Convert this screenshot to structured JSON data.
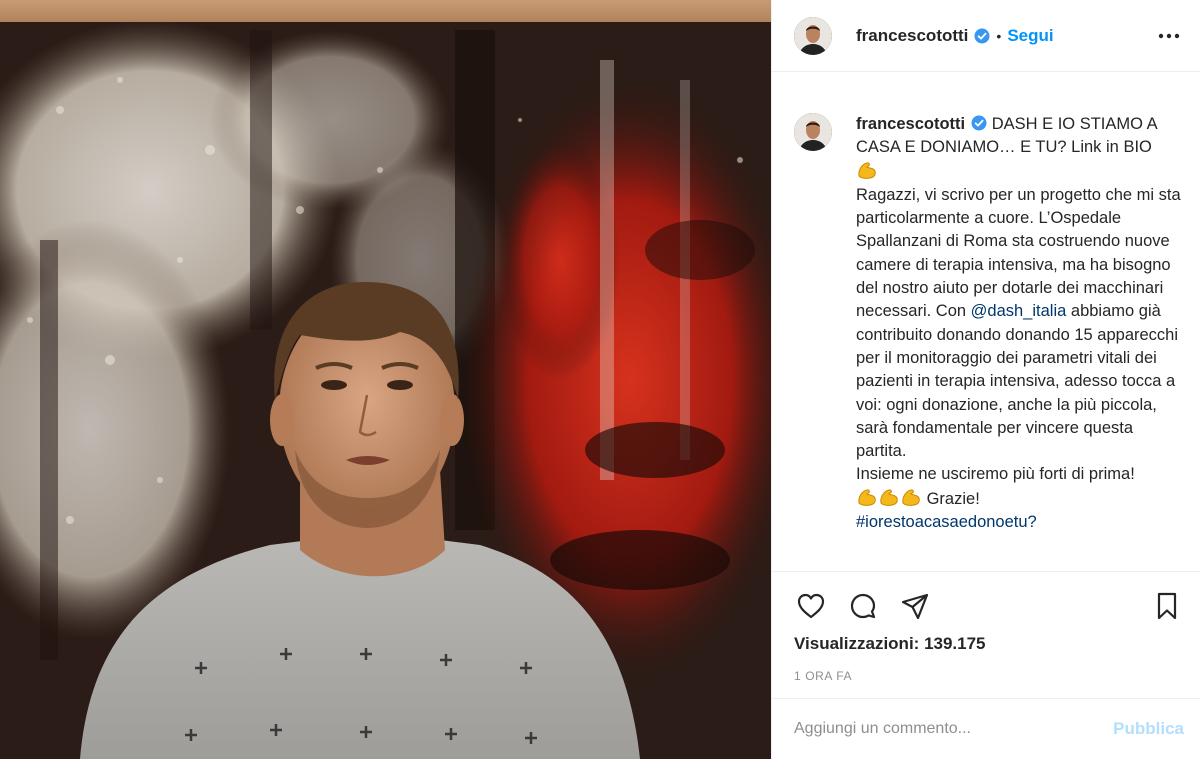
{
  "header": {
    "username": "francescototti",
    "separator": "•",
    "follow_label": "Segui"
  },
  "caption": {
    "username": "francescototti",
    "text_part1": "DASH E IO STIAMO A CASA E DONIAMO… E TU? Link in BIO",
    "text_part2": "Ragazzi, vi scrivo per un progetto che mi sta particolarmente a cuore. L’Ospedale Spallanzani di Roma sta costruendo nuove camere di terapia intensiva, ma ha bisogno del nostro aiuto per dotarle dei macchinari necessari. Con",
    "mention": "@dash_italia",
    "text_part3": "abbiamo già contribuito donando donando 15 apparecchi per il monitoraggio dei parametri vitali dei pazienti in terapia intensiva, adesso tocca a voi: ogni donazione, anche la più piccola, sarà fondamentale per vincere questa partita.",
    "text_part4": "Insieme ne usciremo più forti di prima!",
    "text_part5": "Grazie!",
    "hashtag": "#iorestoacasaedonoetu?"
  },
  "stats": {
    "views_label": "Visualizzazioni:",
    "views_count": "139.175",
    "time_ago": "1 ora fa"
  },
  "comment_box": {
    "placeholder": "Aggiungi un commento...",
    "publish_label": "Pubblica"
  },
  "icons": {
    "verified": "verified-badge-icon",
    "more": "more-options-icon",
    "like": "heart-icon",
    "comment": "comment-bubble-icon",
    "share": "paper-plane-icon",
    "save": "bookmark-icon",
    "emoji": "flexed-biceps-emoji"
  },
  "colors": {
    "link_blue": "#0095f6",
    "publish_disabled": "#b2dffc",
    "verified_blue": "#3897f0",
    "muted_gray": "#8e8e8e",
    "text": "#262626"
  }
}
